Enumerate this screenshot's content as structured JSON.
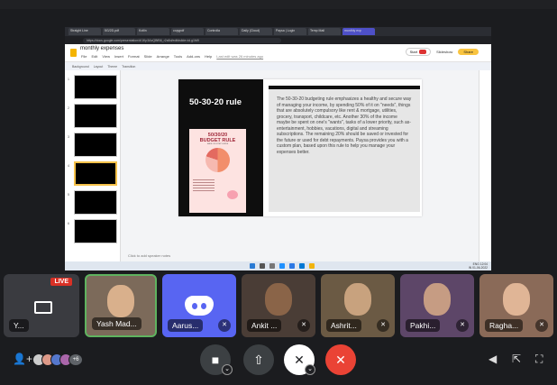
{
  "screen": {
    "browser": {
      "tabs": [
        "Straight Line",
        "5G/2D.pdf",
        "Kotlin",
        "copypdf",
        "Controlla",
        "Daily (Cloud)",
        "Paysa | Login",
        "Temp Mail",
        "monthly exp"
      ],
      "active_tab_index": 8,
      "url": "https://docs.google.com/presentation/d/1Kp3AxQBfB6_r2a5d/edit#slide=id.g1fd9"
    },
    "document": {
      "title": "monthly expenses",
      "menus": [
        "File",
        "Edit",
        "View",
        "Insert",
        "Format",
        "Slide",
        "Arrange",
        "Tools",
        "Add-ons",
        "Help"
      ],
      "last_edit": "Last edit was 26 minutes ago",
      "start_label": "Start",
      "slideshow_label": "Slideshow",
      "share_label": "Share"
    },
    "toolbar": {
      "items": [
        "Background",
        "Layout",
        "Theme",
        "Transition"
      ]
    },
    "thumbnails": {
      "numbers": [
        "1",
        "2",
        "3",
        "4",
        "5",
        "6"
      ],
      "active_index": 3
    },
    "slide": {
      "title": "50-30-20 rule",
      "poster_title": "50/30/20",
      "poster_subtitle": "BUDGET RULE",
      "poster_caption": "SAVE ON STEP GUIDE",
      "body": "The 50-30-20 budgeting rule emphasizes a healthy and secure way of managing your income, by spending 50% of it on \"needs\", things that are absolutely compulsory like rent & mortgage, utilities, grocery, transport, childcare, etc. Another 30% of the income maybe be spent on one's \"wants\", tasks of a lower priority, such as- entertainment, hobbies, vacations, digital and streaming subscriptions. The remaining 20% should be saved or invested for the future or used for debt repayments. Paysa provides you with a custom plan, based upon this rule to help you manage your expenses better."
    },
    "notes_placeholder": "Click to add speaker notes",
    "tray": {
      "lang": "ENG",
      "region": "IN",
      "time": "12:04",
      "date": "01-06-2022"
    }
  },
  "participants": [
    {
      "name": "Y...",
      "live": "LIVE"
    },
    {
      "name": "Yash Mad..."
    },
    {
      "name": "Aarus..."
    },
    {
      "name": "Ankit ..."
    },
    {
      "name": "Ashrit..."
    },
    {
      "name": "Pakhi..."
    },
    {
      "name": "Ragha..."
    }
  ],
  "controls": {
    "participant_count": "+6"
  },
  "colors": {
    "accent": "#4e50c7",
    "leave": "#ea4335",
    "share": "#f9c440",
    "live": "#d93025"
  }
}
